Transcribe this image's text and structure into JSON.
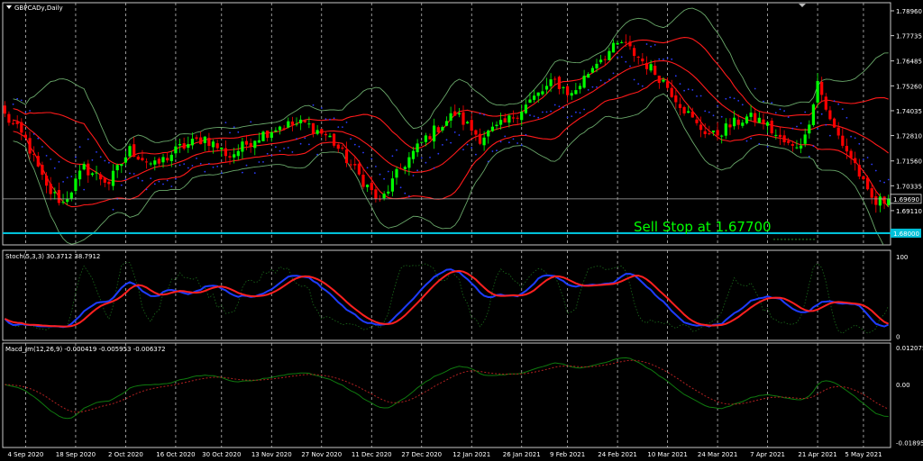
{
  "chart_data": [
    {
      "type": "candlestick",
      "title": "GBPCADy,Daily",
      "indicator_labels": [],
      "y_ticks": [
        1.7896,
        1.77735,
        1.7649,
        1.7526,
        1.74035,
        1.7281,
        1.7156,
        1.70335,
        1.6911
      ],
      "y_tick_labels": [
        "1.78960",
        "1.77735",
        "1.76485",
        "1.75260",
        "1.74035",
        "1.72810",
        "1.71560",
        "1.70335",
        "1.69110"
      ],
      "ylim": [
        1.6742,
        1.7936
      ],
      "current_price": 1.6969,
      "current_price_label": "1.69690",
      "horizontal_line": 1.68,
      "horizontal_line_label": "1.68000",
      "annotation": "Sell Stop at 1.67700",
      "x_labels": [
        "4 Sep 2020",
        "18 Sep 2020",
        "2 Oct 2020",
        "16 Oct 2020",
        "30 Oct 2020",
        "13 Nov 2020",
        "27 Nov 2020",
        "11 Dec 2020",
        "27 Dec 2020",
        "12 Jan 2021",
        "26 Jan 2021",
        "9 Feb 2021",
        "24 Feb 2021",
        "10 Mar 2021",
        "24 Mar 2021",
        "7 Apr 2021",
        "21 Apr 2021",
        "5 May 2021"
      ],
      "close_anchors": [
        [
          0,
          1.738
        ],
        [
          5,
          1.726
        ],
        [
          10,
          1.702
        ],
        [
          14,
          1.695
        ],
        [
          19,
          1.712
        ],
        [
          25,
          1.705
        ],
        [
          30,
          1.721
        ],
        [
          36,
          1.713
        ],
        [
          42,
          1.722
        ],
        [
          48,
          1.727
        ],
        [
          54,
          1.718
        ],
        [
          60,
          1.727
        ],
        [
          66,
          1.733
        ],
        [
          72,
          1.734
        ],
        [
          78,
          1.727
        ],
        [
          84,
          1.711
        ],
        [
          90,
          1.695
        ],
        [
          95,
          1.712
        ],
        [
          101,
          1.727
        ],
        [
          108,
          1.739
        ],
        [
          114,
          1.727
        ],
        [
          120,
          1.734
        ],
        [
          126,
          1.745
        ],
        [
          132,
          1.755
        ],
        [
          136,
          1.748
        ],
        [
          142,
          1.765
        ],
        [
          148,
          1.774
        ],
        [
          154,
          1.763
        ],
        [
          158,
          1.755
        ],
        [
          162,
          1.744
        ],
        [
          166,
          1.733
        ],
        [
          170,
          1.728
        ],
        [
          174,
          1.733
        ],
        [
          178,
          1.737
        ],
        [
          182,
          1.735
        ],
        [
          186,
          1.726
        ],
        [
          189,
          1.722
        ],
        [
          192,
          1.727
        ],
        [
          195,
          1.755
        ],
        [
          198,
          1.735
        ],
        [
          201,
          1.724
        ],
        [
          204,
          1.714
        ],
        [
          207,
          1.699
        ],
        [
          209,
          1.6945
        ],
        [
          211,
          1.6969
        ]
      ]
    },
    {
      "type": "line",
      "title": "Stoch(5,3,3) 30.3712 38.7912",
      "y_ticks": [
        100,
        0
      ],
      "y_tick_labels": [
        "100",
        "0"
      ],
      "ylim": [
        -5,
        108
      ],
      "series": [
        {
          "color": "#1e3cff",
          "values": []
        },
        {
          "color": "#ff2020",
          "values": []
        }
      ]
    },
    {
      "type": "line",
      "title": "Macd_Jm(12,26,9) -0.000419 -0.005953 -0.006372",
      "y_ticks": [
        0.012075,
        0.0,
        -0.018952
      ],
      "y_tick_labels": [
        "0.012075",
        "0.00",
        "-0.018952"
      ],
      "ylim": [
        -0.0205,
        0.0135
      ],
      "series": [
        {
          "color": "#0f7a0f",
          "values": []
        },
        {
          "color": "#b02020",
          "values": []
        }
      ]
    }
  ],
  "colors": {
    "bull": "#00ff00",
    "bear": "#ff0000",
    "band_outer": "#6aa86a",
    "band_inner": "#ff1a1a",
    "parabolic": "#2b3cff",
    "price_line": "#00c0d8",
    "annotation": "#00ff00"
  }
}
